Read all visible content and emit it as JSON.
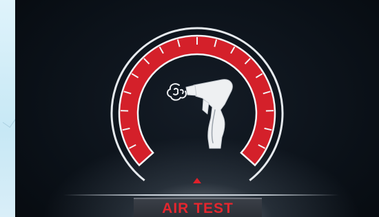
{
  "gauge": {
    "label": "AIR TEST",
    "accent_color": "#d4202a",
    "outline_color": "#e6eaee",
    "icon": "air-blowgun-icon",
    "indicator_icon": "triangle-indicator-icon"
  }
}
